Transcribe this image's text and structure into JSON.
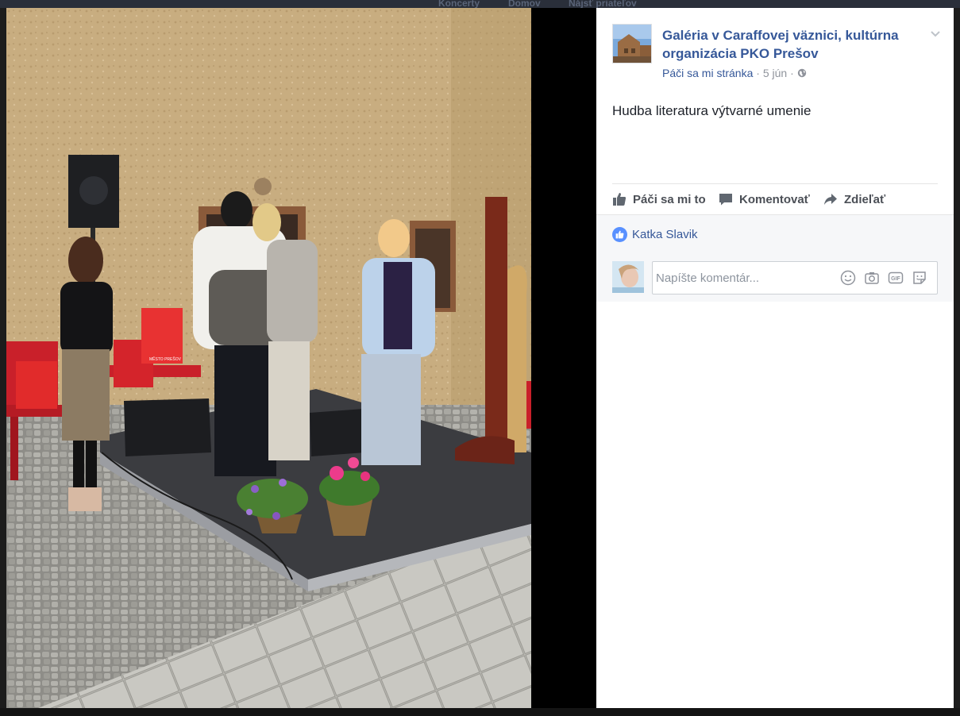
{
  "background_nav": {
    "items": [
      "Koncerty",
      "Domov",
      "Nájsť priateľov"
    ]
  },
  "post": {
    "page_name": "Galéria v Caraffovej väznici, kultúrna organizácia PKO Prešov",
    "like_page_label": "Páči sa mi stránka",
    "separator": "·",
    "date": "5 jún",
    "text": "Hudba literatura výtvarné umenie"
  },
  "actions": {
    "like_label": "Páči sa mi to",
    "comment_label": "Komentovať",
    "share_label": "Zdieľať"
  },
  "likes": {
    "liker": "Katka Slavik"
  },
  "comment_input": {
    "placeholder": "Napíšte komentár...",
    "gif_label": "GIF"
  },
  "photo": {
    "bag_text": "MĚSTO PREŠOV"
  },
  "colors": {
    "link": "#365899",
    "like_blue": "#5890ff",
    "panel_bg": "#ffffff",
    "likes_bg": "#f6f7f9"
  }
}
